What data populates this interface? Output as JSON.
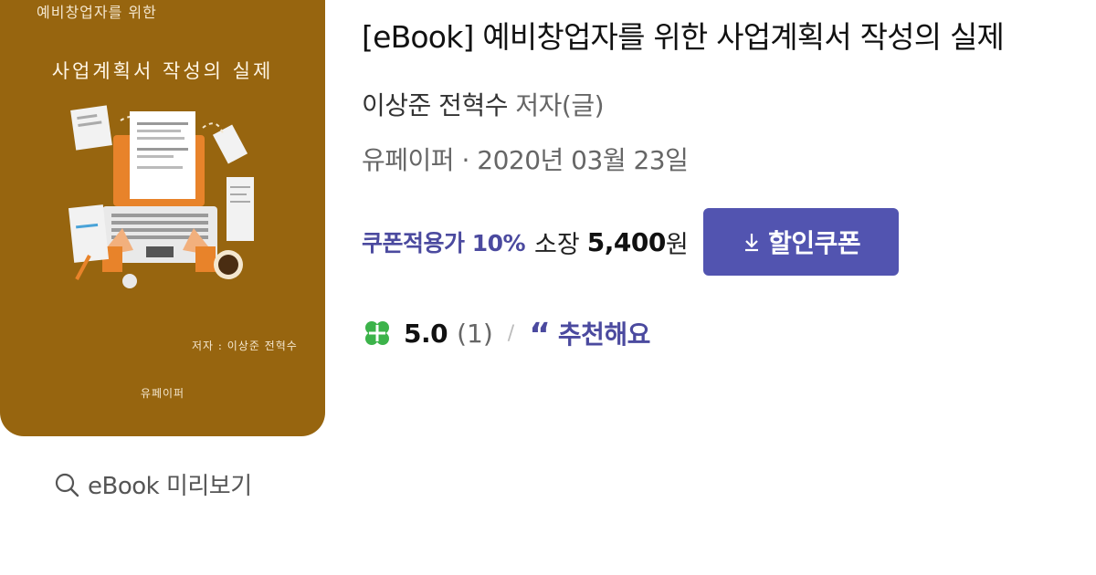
{
  "cover": {
    "top_text": "예비창업자를 위한",
    "title": "사업계획서 작성의 실제",
    "author": "저자 : 이상준 전혁수",
    "publisher": "유페이퍼"
  },
  "preview": {
    "label": "eBook 미리보기",
    "icon": "search-icon"
  },
  "book": {
    "title": "[eBook] 예비창업자를 위한 사업계획서 작성의 실제",
    "authors": "이상준 전혁수",
    "author_role": "저자(글)",
    "publisher": "유페이퍼",
    "separator": "·",
    "date": "2020년 03월 23일"
  },
  "price": {
    "coupon_text": "쿠폰적용가 10%",
    "own_label": "소장",
    "amount": "5,400",
    "currency": "원",
    "coupon_button": "할인쿠폰",
    "coupon_button_icon": "download-icon"
  },
  "rating": {
    "icon": "clover-icon",
    "score": "5.0",
    "count": "(1)",
    "divider": "/",
    "quote_icon": "quote-icon",
    "recommend": "추천해요"
  },
  "colors": {
    "cover_bg": "#97650f",
    "accent": "#4b4a9f",
    "button_bg": "#5254b0",
    "clover": "#3cb34a"
  }
}
